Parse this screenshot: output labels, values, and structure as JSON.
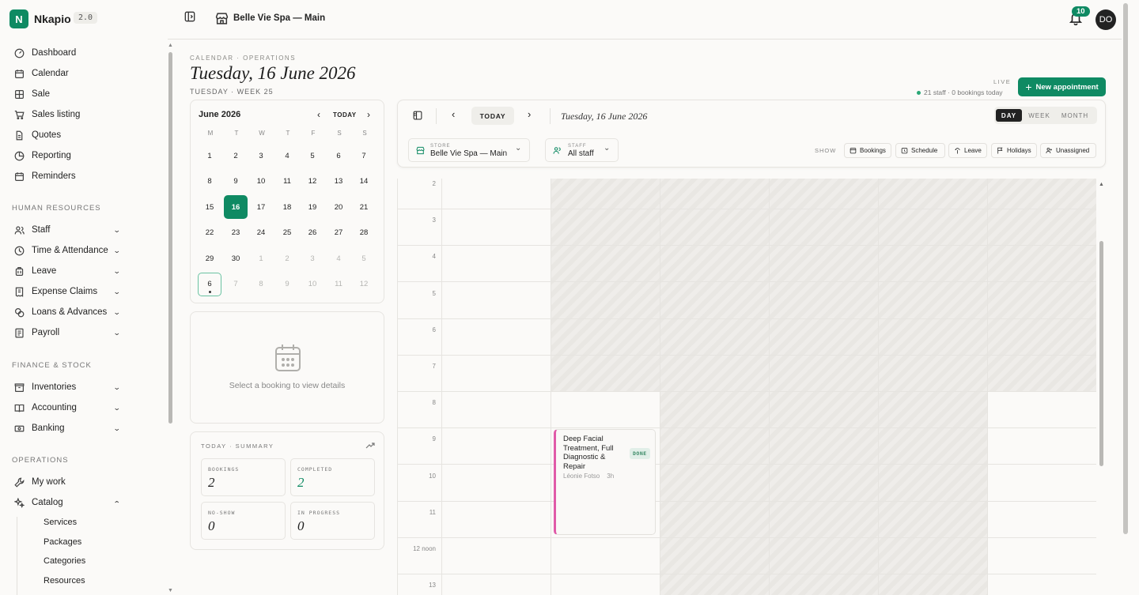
{
  "app": {
    "name": "Nkapio",
    "version": "2.0"
  },
  "topbar": {
    "store_title": "Belle Vie Spa — Main",
    "notifications": "10",
    "avatar": "DO"
  },
  "sidebar": {
    "items": [
      {
        "label": "Dashboard",
        "icon": "gauge-icon"
      },
      {
        "label": "Calendar",
        "icon": "calendar-icon"
      },
      {
        "label": "Sale",
        "icon": "grid-icon"
      },
      {
        "label": "Sales listing",
        "icon": "cart-icon"
      },
      {
        "label": "Quotes",
        "icon": "document-icon"
      },
      {
        "label": "Reporting",
        "icon": "pie-chart-icon"
      },
      {
        "label": "Reminders",
        "icon": "calendar-clock-icon"
      }
    ],
    "hr_title": "HUMAN RESOURCES",
    "hr_items": [
      {
        "label": "Staff",
        "icon": "users-icon"
      },
      {
        "label": "Time & Attendance",
        "icon": "clock-icon"
      },
      {
        "label": "Leave",
        "icon": "luggage-icon"
      },
      {
        "label": "Expense Claims",
        "icon": "receipt-icon"
      },
      {
        "label": "Loans & Advances",
        "icon": "coins-icon"
      },
      {
        "label": "Payroll",
        "icon": "payroll-icon"
      }
    ],
    "fin_title": "FINANCE & STOCK",
    "fin_items": [
      {
        "label": "Inventories",
        "icon": "box-icon"
      },
      {
        "label": "Accounting",
        "icon": "book-icon"
      },
      {
        "label": "Banking",
        "icon": "banknote-icon"
      }
    ],
    "ops_title": "OPERATIONS",
    "ops_items": [
      {
        "label": "My work",
        "icon": "wrench-icon"
      },
      {
        "label": "Catalog",
        "icon": "sparkle-icon"
      }
    ],
    "catalog_sub": [
      "Services",
      "Packages",
      "Categories",
      "Resources"
    ]
  },
  "header": {
    "crumb": "CALENDAR · OPERATIONS",
    "title": "Tuesday, 16 June 2026",
    "subtitle": "TUESDAY · WEEK 25",
    "live": "LIVE",
    "staff_info": "21 staff · 0 bookings today",
    "new_button": "New appointment"
  },
  "mini_calendar": {
    "month": "June 2026",
    "today_label": "TODAY",
    "dow": [
      "M",
      "T",
      "W",
      "T",
      "F",
      "S",
      "S"
    ],
    "weeks": [
      [
        "1",
        "2",
        "3",
        "4",
        "5",
        "6",
        "7"
      ],
      [
        "8",
        "9",
        "10",
        "11",
        "12",
        "13",
        "14"
      ],
      [
        "15",
        "16",
        "17",
        "18",
        "19",
        "20",
        "21"
      ],
      [
        "22",
        "23",
        "24",
        "25",
        "26",
        "27",
        "28"
      ],
      [
        "29",
        "30",
        "1",
        "2",
        "3",
        "4",
        "5"
      ],
      [
        "6",
        "7",
        "8",
        "9",
        "10",
        "11",
        "12"
      ]
    ],
    "selected": "16"
  },
  "details": {
    "empty_text": "Select a booking to view details"
  },
  "summary": {
    "title": "TODAY · SUMMARY",
    "stats": [
      {
        "label": "BOOKINGS",
        "value": "2"
      },
      {
        "label": "COMPLETED",
        "value": "2"
      },
      {
        "label": "NO-SHOW",
        "value": "0"
      },
      {
        "label": "IN PROGRESS",
        "value": "0"
      }
    ]
  },
  "toolbar": {
    "today": "TODAY",
    "date": "Tuesday, 16 June 2026",
    "views": [
      "DAY",
      "WEEK",
      "MONTH"
    ],
    "active_view": "DAY",
    "store_caption": "STORE",
    "store_value": "Belle Vie Spa — Main",
    "staff_caption": "STAFF",
    "staff_value": "All staff",
    "show_label": "SHOW",
    "filters": [
      "Bookings",
      "Schedule",
      "Leave",
      "Holidays",
      "Unassigned"
    ]
  },
  "grid": {
    "hours": [
      "2",
      "3",
      "4",
      "5",
      "6",
      "7",
      "8",
      "9",
      "10",
      "11",
      "12 noon",
      "13"
    ]
  },
  "appointment": {
    "title": "Deep Facial Treatment, Full Diagnostic & Repair",
    "staff": "Léonie Fotso",
    "duration": "3h",
    "status": "DONE",
    "color": "#e05aa8"
  }
}
